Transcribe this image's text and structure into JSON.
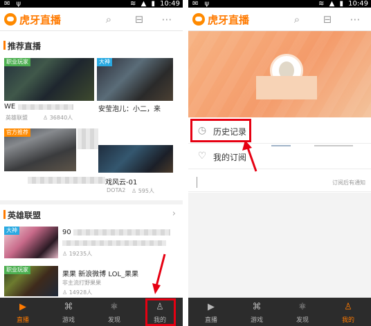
{
  "status": {
    "time": "10:49",
    "battery": "▮",
    "signal": "▲"
  },
  "left": {
    "brand": "虎牙直播",
    "section1": "推荐直播",
    "section2": "英雄联盟",
    "items": [
      {
        "badge": "职业玩家",
        "title": "WE",
        "meta_icon": "英雄联盟",
        "viewers": "36840人"
      },
      {
        "badge": "大神",
        "title": "安莹泡儿：小二，来",
        "meta_icon": "",
        "viewers": ""
      },
      {
        "badge": "官方推荐",
        "title": "",
        "meta_icon": "",
        "viewers": ""
      },
      {
        "badge": "",
        "title": "戏风云-01",
        "meta_icon": "DOTA2",
        "viewers": "595人"
      }
    ],
    "lol_items": [
      {
        "badge": "大神",
        "title": "90",
        "meta": "19235人"
      },
      {
        "badge": "职业玩家",
        "title": "果果  新浪微博  LOL_果果",
        "meta": "非主流打野果果",
        "viewers": "14928人"
      }
    ],
    "nav": [
      {
        "label": "直播",
        "icon": "play-icon"
      },
      {
        "label": "游戏",
        "icon": "gamepad-icon"
      },
      {
        "label": "发现",
        "icon": "atom-icon"
      },
      {
        "label": "我的",
        "icon": "user-icon"
      }
    ]
  },
  "right": {
    "brand": "虎牙直播",
    "menu": [
      {
        "label": "历史记录",
        "icon": "history-icon"
      },
      {
        "label": "我的订阅",
        "icon": "heart-icon"
      }
    ],
    "notice": "订阅后有通知",
    "nav": [
      {
        "label": "直播",
        "icon": "play-icon"
      },
      {
        "label": "游戏",
        "icon": "gamepad-icon"
      },
      {
        "label": "发现",
        "icon": "atom-icon"
      },
      {
        "label": "我的",
        "icon": "user-icon"
      }
    ]
  },
  "colors": {
    "accent": "#ff7a00",
    "annotation": "#e60012",
    "nav_bg": "#2c2c2c"
  }
}
